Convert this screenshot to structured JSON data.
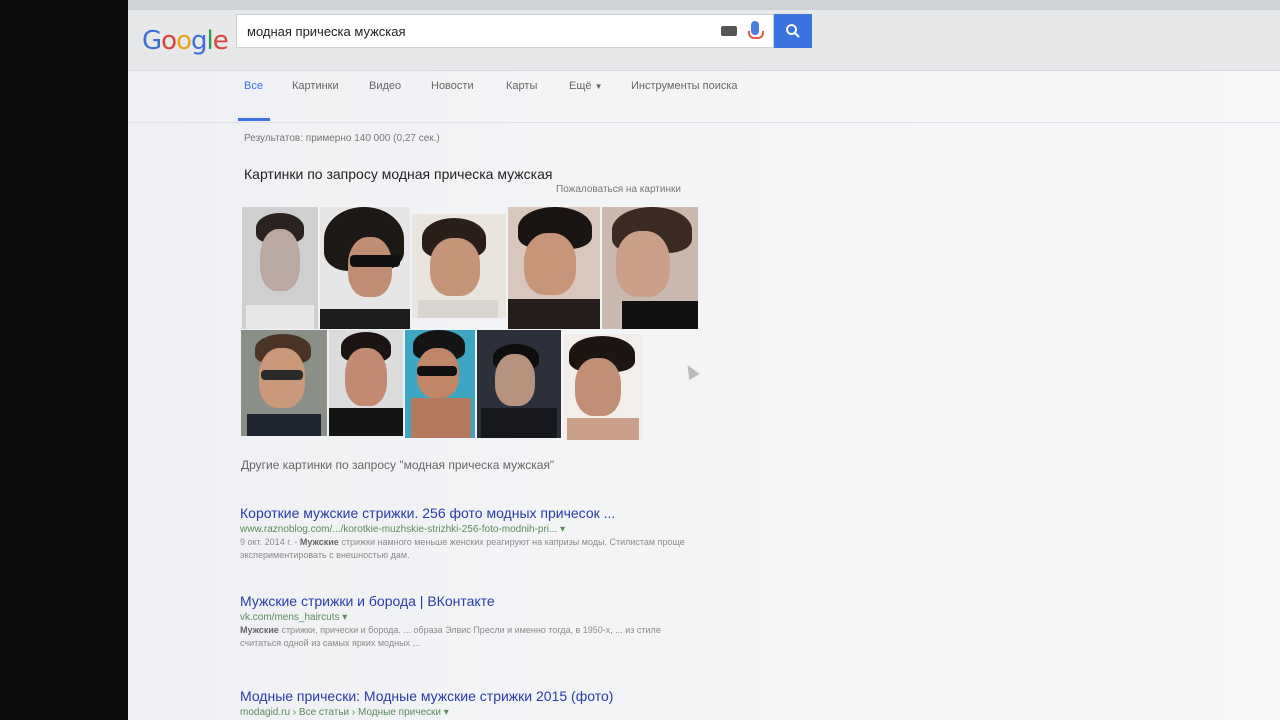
{
  "search": {
    "logo": "Google",
    "query": "модная прическа мужская"
  },
  "tabs": [
    {
      "label": "Все"
    },
    {
      "label": "Картинки"
    },
    {
      "label": "Видео"
    },
    {
      "label": "Новости"
    },
    {
      "label": "Карты"
    },
    {
      "label": "Ещё"
    },
    {
      "label": "Инструменты поиска"
    }
  ],
  "result_stats": "Результатов: примерно 140 000 (0,27 сек.)",
  "images_section": {
    "heading": "Картинки по запросу модная прическа мужская",
    "report_link": "Пожаловаться на картинки",
    "more_link": "Другие картинки по запросу \"модная прическа мужская\""
  },
  "results": [
    {
      "title": "Короткие мужские стрижки. 256 фото модных причесок ...",
      "url": "www.raznoblog.com/.../korotkie-muzhskie-strizhki-256-foto-modnih-pri...",
      "date": "9 окт. 2014 г.",
      "snippet_bold": "Мужские",
      "snippet": " стрижки намного меньше женских реагируют на капризы моды. Стилистам проще экспериментировать с внешностью дам."
    },
    {
      "title": "Мужские стрижки и борода | ВКонтакте",
      "url": "vk.com/mens_haircuts",
      "date": "",
      "snippet_bold": "Мужские",
      "snippet": " стрижки, прически и борода. ... образа Элвис Пресли и именно тогда, в 1950-х, ... из стиле считаться одной из самых ярких модных ..."
    },
    {
      "title": "Модные прически: Модные мужские стрижки 2015 (фото)",
      "url": "modagid.ru › Все статьи › Модные прически",
      "date": "",
      "snippet_bold": "",
      "snippet": ""
    }
  ]
}
